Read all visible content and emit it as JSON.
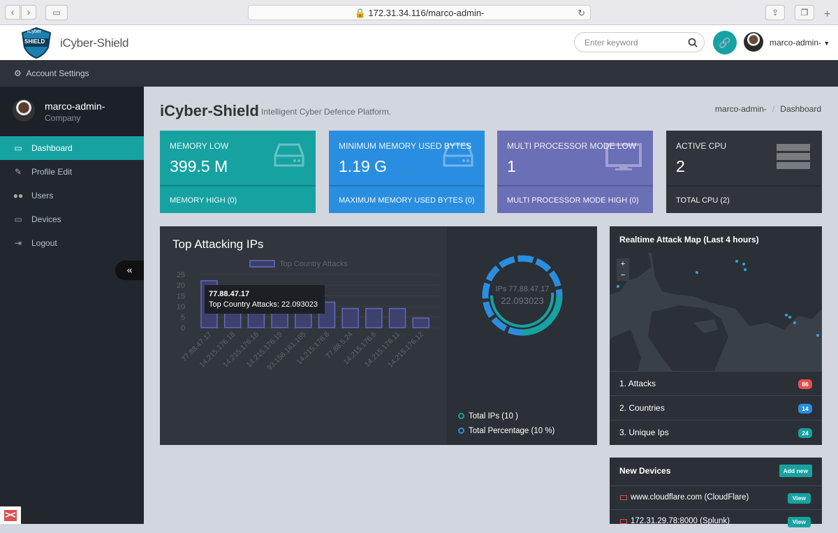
{
  "browser": {
    "url": "172.31.34.116/marco-admin-"
  },
  "header": {
    "brand": "iCyber-Shield",
    "logo_text_top": "iCyber",
    "logo_text_main": "SHIELD",
    "search_placeholder": "Enter keyword",
    "username": "marco-admin-"
  },
  "account_bar": {
    "label": "Account Settings"
  },
  "sidebar": {
    "profile_name": "marco-admin-",
    "profile_company": "Company",
    "items": [
      {
        "label": "Dashboard",
        "icon": "monitor-icon"
      },
      {
        "label": "Profile Edit",
        "icon": "edit-icon"
      },
      {
        "label": "Users",
        "icon": "users-icon"
      },
      {
        "label": "Devices",
        "icon": "laptop-icon"
      },
      {
        "label": "Logout",
        "icon": "logout-icon"
      }
    ],
    "collapse": "«"
  },
  "page": {
    "title": "iCyber-Shield",
    "subtitle": "Intelligent Cyber Defence Platform.",
    "breadcrumb": [
      "marco-admin-",
      "Dashboard"
    ]
  },
  "stats": [
    {
      "label": "MEMORY LOW",
      "value": "399.5 M",
      "footer": "MEMORY HIGH (0)",
      "color": "#17a2a2"
    },
    {
      "label": "MINIMUM MEMORY USED BYTES",
      "value": "1.19 G",
      "footer": "MAXIMUM MEMORY USED BYTES (0)",
      "color": "#2a8ee0"
    },
    {
      "label": "MULTI PROCESSOR MODE LOW",
      "value": "1",
      "footer": "MULTI PROCESSOR MODE HIGH (0)",
      "color": "#6b6fb5"
    },
    {
      "label": "ACTIVE CPU",
      "value": "2",
      "footer": "TOTAL CPU (2)",
      "color": "#30343b"
    }
  ],
  "attack_panel": {
    "title": "Top Attacking IPs",
    "tooltip_ip": "77.88.47.17",
    "tooltip_text": "Top Country Attacks: 22.093023",
    "donut_label": "IPs 77.88.47.17",
    "donut_value": "22.093023",
    "total_ips": "Total IPs (10 )",
    "total_percentage": "Total Percentage (10 %)"
  },
  "chart_data": {
    "type": "bar",
    "legend": "Top Country Attacks",
    "categories": [
      "77.88.47.17",
      "14.215.176.18",
      "14.215.176.16",
      "14.215.176.19",
      "93.158.161.165",
      "14.215.176.8",
      "77.88.5.24",
      "14.215.176.6",
      "14.215.176.11",
      "14.215.176.12"
    ],
    "values": [
      22.093023,
      15,
      15,
      15,
      14,
      12,
      9,
      9,
      9,
      4.5
    ],
    "ylim": [
      0,
      25
    ],
    "yticks": [
      "0",
      "5",
      "10",
      "15",
      "20",
      "25"
    ]
  },
  "map_panel": {
    "title": "Realtime Attack Map (Last 4 hours)",
    "zoom_in": "+",
    "zoom_out": "−",
    "rows": [
      {
        "label": "1. Attacks",
        "count": "86",
        "color": "#e0514c"
      },
      {
        "label": "2. Countries",
        "count": "14",
        "color": "#2a8ee0"
      },
      {
        "label": "3. Unique Ips",
        "count": "24",
        "color": "#17a2a2"
      }
    ]
  },
  "devices_panel": {
    "title": "New Devices",
    "add_label": "Add new",
    "items": [
      {
        "name": "www.cloudflare.com (CloudFlare)",
        "action": "View"
      },
      {
        "name": "172.31.29.78:8000 (Splunk)",
        "action": "View"
      }
    ]
  }
}
